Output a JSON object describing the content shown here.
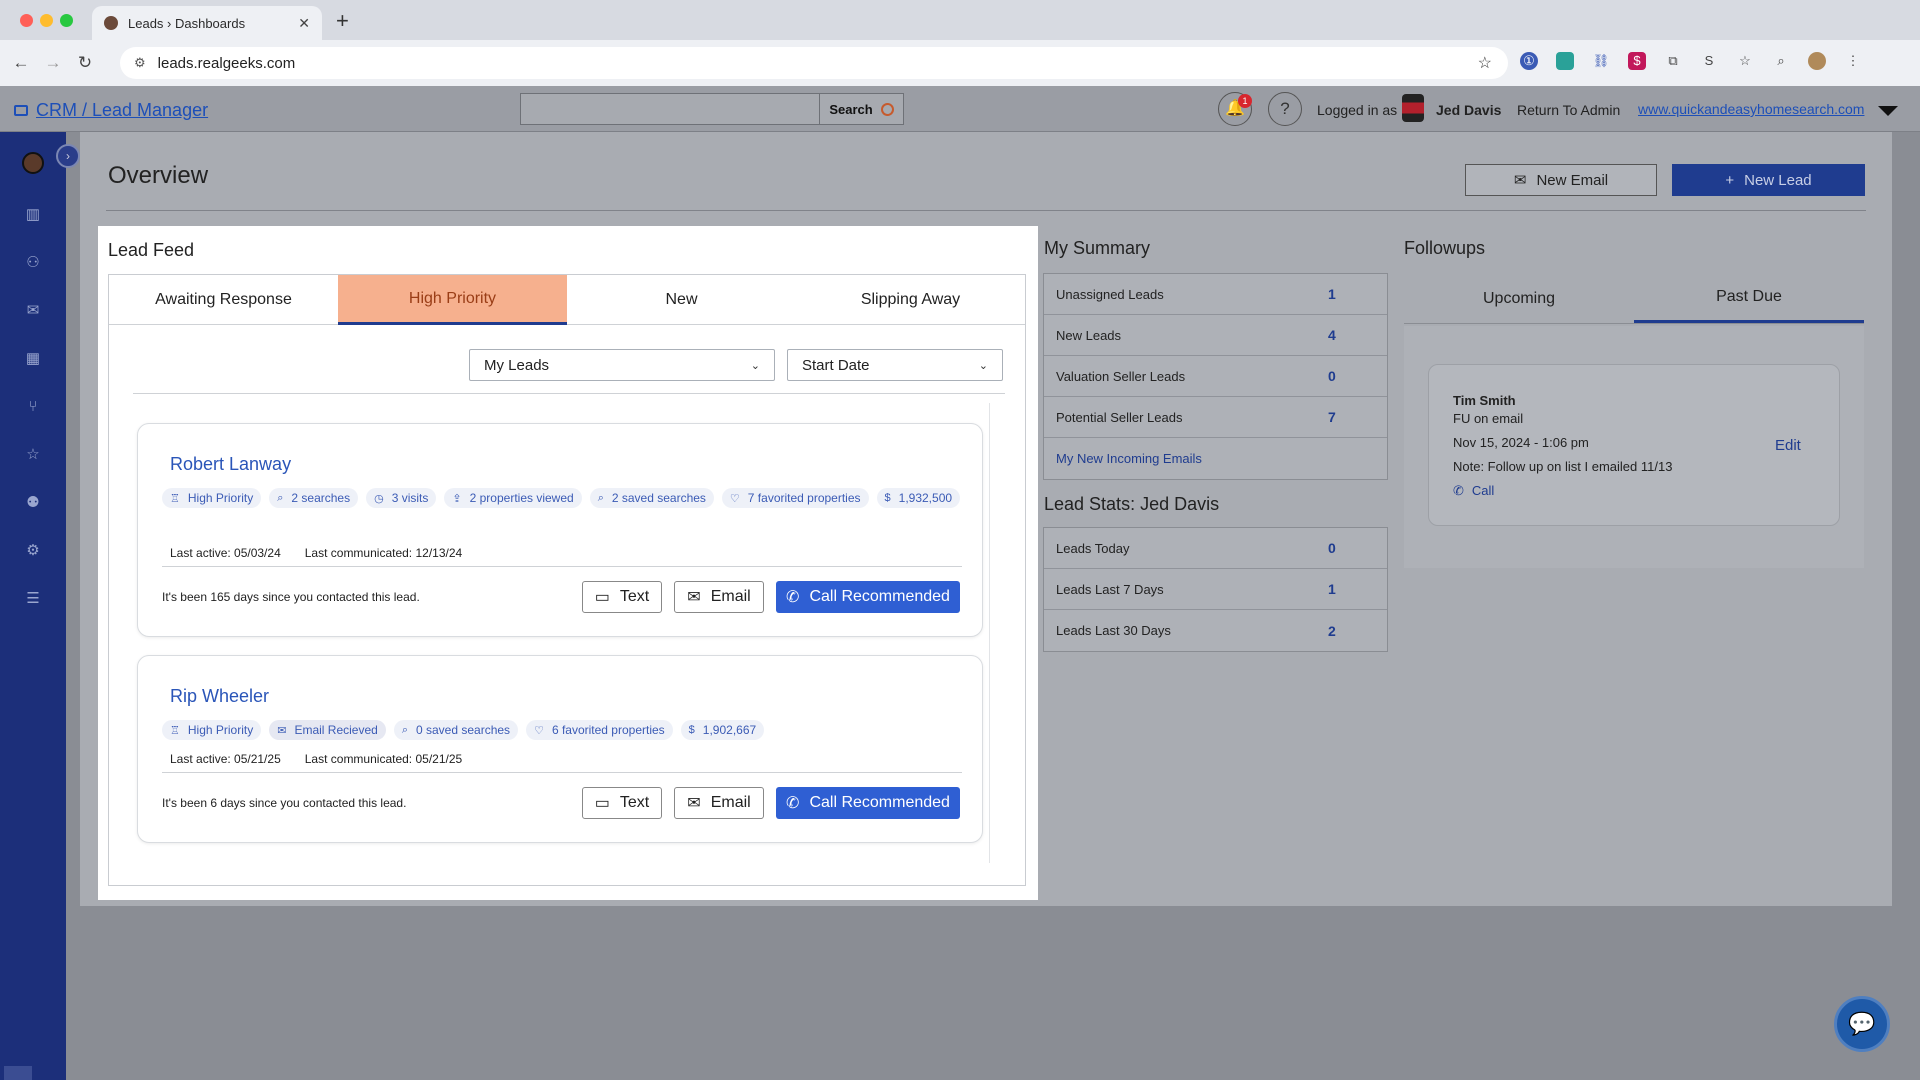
{
  "browser": {
    "tab_title": "Leads › Dashboards",
    "url": "leads.realgeeks.com"
  },
  "header": {
    "crm_title": "CRM / Lead Manager",
    "search_label": "Search",
    "notification_count": "1",
    "logged_in_prefix": "Logged in as",
    "user_name": "Jed Davis",
    "return_to_admin": "Return To Admin",
    "site_link": "www.quickandeasyhomesearch.com"
  },
  "overview": {
    "title": "Overview",
    "new_email_label": "New Email",
    "new_lead_label": "New Lead"
  },
  "lead_feed": {
    "title": "Lead Feed",
    "tabs": [
      "Awaiting Response",
      "High Priority",
      "New",
      "Slipping Away"
    ],
    "active_tab": "High Priority",
    "filter_owner": "My Leads",
    "filter_date": "Start Date",
    "leads": [
      {
        "name": "Robert Lanway",
        "chips": [
          {
            "icon": "ribbon-icon",
            "label": "High Priority"
          },
          {
            "icon": "search-icon",
            "label": "2 searches"
          },
          {
            "icon": "clock-icon",
            "label": "3 visits"
          },
          {
            "icon": "share-icon",
            "label": "2 properties viewed"
          },
          {
            "icon": "saved-search-icon",
            "label": "2 saved searches"
          },
          {
            "icon": "heart-icon",
            "label": "7 favorited properties"
          },
          {
            "icon": "dollar-icon",
            "label": "1,932,500"
          }
        ],
        "last_active": "Last active: 05/03/24",
        "last_communicated": "Last communicated: 12/13/24",
        "since_text": "It's been 165 days since you contacted this lead."
      },
      {
        "name": "Rip Wheeler",
        "chips": [
          {
            "icon": "ribbon-icon",
            "label": "High Priority"
          },
          {
            "icon": "mail-icon",
            "label": "Email Recieved"
          },
          {
            "icon": "saved-search-icon",
            "label": "0 saved searches"
          },
          {
            "icon": "heart-icon",
            "label": "6 favorited properties"
          },
          {
            "icon": "dollar-icon",
            "label": "1,902,667"
          }
        ],
        "last_active": "Last active: 05/21/25",
        "last_communicated": "Last communicated: 05/21/25",
        "since_text": "It's been 6 days since you contacted this lead."
      }
    ],
    "actions": {
      "text_label": "Text",
      "email_label": "Email",
      "call_label": "Call Recommended"
    }
  },
  "my_summary": {
    "title": "My Summary",
    "rows": [
      {
        "label": "Unassigned Leads",
        "value": "1"
      },
      {
        "label": "New Leads",
        "value": "4"
      },
      {
        "label": "Valuation Seller Leads",
        "value": "0"
      },
      {
        "label": "Potential Seller Leads",
        "value": "7"
      }
    ],
    "incoming_emails_link": "My New Incoming Emails"
  },
  "lead_stats": {
    "title": "Lead Stats: Jed Davis",
    "rows": [
      {
        "label": "Leads Today",
        "value": "0"
      },
      {
        "label": "Leads Last 7 Days",
        "value": "1"
      },
      {
        "label": "Leads Last 30 Days",
        "value": "2"
      }
    ]
  },
  "followups": {
    "title": "Followups",
    "tabs": [
      "Upcoming",
      "Past Due"
    ],
    "active_tab": "Past Due",
    "item": {
      "name": "Tim Smith",
      "subject": "FU on email",
      "datetime": "Nov 15, 2024 - 1:06 pm",
      "note": "Note: Follow up on list I emailed 11/13",
      "call_label": "Call",
      "edit_label": "Edit"
    }
  },
  "colors": {
    "brand_blue": "#1f3c8f",
    "call_blue": "#2f5fd3",
    "active_tab_bg": "#f6b08e",
    "sidebar": "#1c2f7a"
  }
}
